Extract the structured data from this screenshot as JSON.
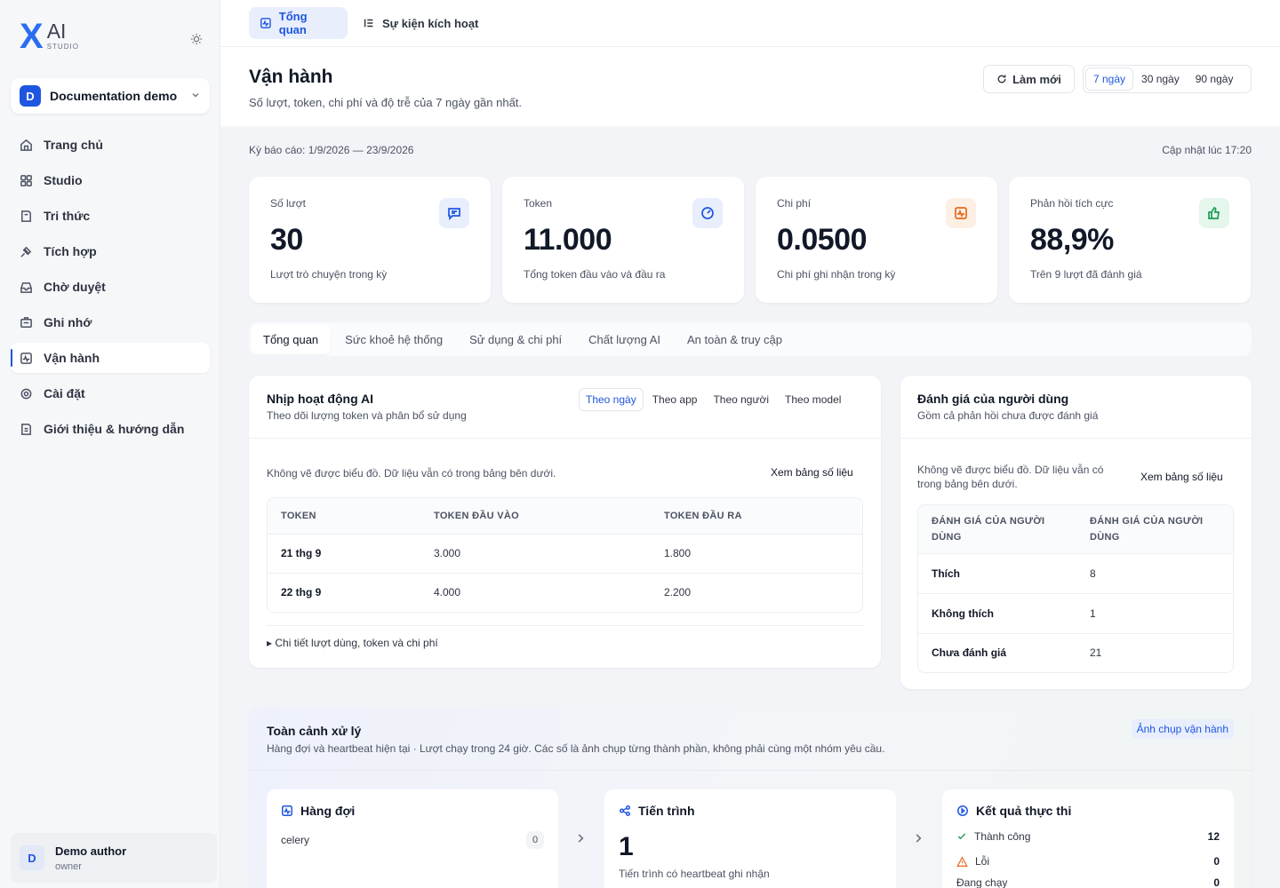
{
  "brand": {
    "mark": "X",
    "name": "AI",
    "sub": "STUDIO"
  },
  "workspace": {
    "initial": "D",
    "name": "Documentation demo"
  },
  "nav": [
    {
      "label": "Trang chủ",
      "icon": "home-icon"
    },
    {
      "label": "Studio",
      "icon": "grid-icon"
    },
    {
      "label": "Tri thức",
      "icon": "book-icon"
    },
    {
      "label": "Tích hợp",
      "icon": "plug-icon"
    },
    {
      "label": "Chờ duyệt",
      "icon": "inbox-icon"
    },
    {
      "label": "Ghi nhớ",
      "icon": "memory-icon"
    },
    {
      "label": "Vận hành",
      "icon": "activity-icon",
      "active": true
    },
    {
      "label": "Cài đặt",
      "icon": "gear-icon"
    },
    {
      "label": "Giới thiệu & hướng dẫn",
      "icon": "guide-icon"
    }
  ],
  "user": {
    "initial": "D",
    "name": "Demo author",
    "role": "owner"
  },
  "top_tabs": [
    {
      "label": "Tổng quan",
      "active": true
    },
    {
      "label": "Sự kiện kích hoạt"
    }
  ],
  "page": {
    "title": "Vận hành",
    "subtitle": "Số lượt, token, chi phí và độ trễ của 7 ngày gần nhất.",
    "refresh_label": "Làm mới",
    "ranges": [
      "7 ngày",
      "30 ngày",
      "90 ngày"
    ],
    "active_range": "7 ngày",
    "period": "Kỳ báo cáo: 1/9/2026 — 23/9/2026",
    "updated": "Cập nhật lúc 17:20"
  },
  "kpis": [
    {
      "label": "Số lượt",
      "value": "30",
      "desc": "Lượt trò chuyện trong kỳ",
      "icon": "chat-icon",
      "color": "#1f56e0",
      "bg": "#e8eefc"
    },
    {
      "label": "Token",
      "value": "11.000",
      "desc": "Tổng token đầu vào và đầu ra",
      "icon": "gauge-icon",
      "color": "#1f56e0",
      "bg": "#e8eefc"
    },
    {
      "label": "Chi phí",
      "value": "0.0500",
      "desc": "Chi phí ghi nhận trong kỳ",
      "icon": "pulse-icon",
      "color": "#e26a1b",
      "bg": "#fdefe4"
    },
    {
      "label": "Phản hồi tích cực",
      "value": "88,9%",
      "desc": "Trên 9 lượt đã đánh giá",
      "icon": "thumbs-up-icon",
      "color": "#1d9a55",
      "bg": "#e5f6ec"
    }
  ],
  "section_tabs": [
    "Tổng quan",
    "Sức khoẻ hệ thống",
    "Sử dụng & chi phí",
    "Chất lượng AI",
    "An toàn & truy cập"
  ],
  "activity": {
    "title": "Nhịp hoạt động AI",
    "subtitle": "Theo dõi lượng token và phân bổ sử dụng",
    "segments": [
      "Theo ngày",
      "Theo app",
      "Theo người",
      "Theo model"
    ],
    "note": "Không vẽ được biểu đồ. Dữ liệu vẫn có trong bảng bên dưới.",
    "link": "Xem bảng số liệu",
    "columns": [
      "TOKEN",
      "TOKEN ĐẦU VÀO",
      "TOKEN ĐẦU RA"
    ],
    "rows": [
      [
        "21 thg 9",
        "3.000",
        "1.800"
      ],
      [
        "22 thg 9",
        "4.000",
        "2.200"
      ]
    ],
    "details": "Chi tiết lượt dùng, token và chi phí"
  },
  "feedback": {
    "title": "Đánh giá của người dùng",
    "subtitle": "Gồm cả phản hồi chưa được đánh giá",
    "note": "Không vẽ được biểu đồ. Dữ liệu vẫn có trong bảng bên dưới.",
    "link": "Xem bảng số liệu",
    "columns": [
      "ĐÁNH GIÁ CỦA NGƯỜI DÙNG",
      "ĐÁNH GIÁ CỦA NGƯỜI DÙNG"
    ],
    "rows": [
      [
        "Thích",
        "8"
      ],
      [
        "Không thích",
        "1"
      ],
      [
        "Chưa đánh giá",
        "21"
      ]
    ]
  },
  "overview": {
    "title": "Toàn cảnh xử lý",
    "subtitle": "Hàng đợi và heartbeat hiện tại · Lượt chạy trong 24 giờ. Các số là ảnh chụp từng thành phần, không phải cùng một nhóm yêu cầu.",
    "badge": "Ảnh chụp vận hành",
    "queue": {
      "title": "Hàng đợi",
      "name": "celery",
      "count": "0"
    },
    "process": {
      "title": "Tiến trình",
      "value": "1",
      "desc": "Tiến trình có heartbeat ghi nhận"
    },
    "results": {
      "title": "Kết quả thực thi",
      "rows": [
        {
          "label": "Thành công",
          "value": "12"
        },
        {
          "label": "Lỗi",
          "value": "0"
        },
        {
          "label": "Đang chạy",
          "value": "0"
        }
      ]
    }
  }
}
